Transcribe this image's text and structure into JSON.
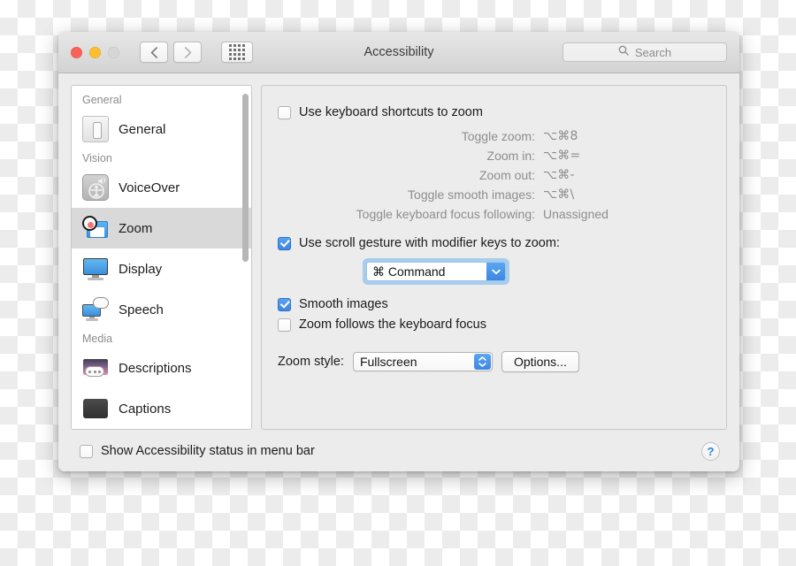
{
  "window": {
    "title": "Accessibility",
    "traffic_lights": [
      "close",
      "minimize",
      "zoom"
    ],
    "toolbar": {
      "back_icon": "chevron-left-icon",
      "forward_icon": "chevron-right-icon",
      "grid_icon": "show-all-grid-icon"
    },
    "search": {
      "placeholder": "Search",
      "icon": "search-icon"
    }
  },
  "sidebar": {
    "groups": [
      {
        "label": "General",
        "items": [
          {
            "label": "General",
            "icon": "general-switch-icon",
            "selected": false
          }
        ]
      },
      {
        "label": "Vision",
        "items": [
          {
            "label": "VoiceOver",
            "icon": "voiceover-icon",
            "selected": false
          },
          {
            "label": "Zoom",
            "icon": "zoom-icon",
            "selected": true
          },
          {
            "label": "Display",
            "icon": "display-monitor-icon",
            "selected": false
          },
          {
            "label": "Speech",
            "icon": "speech-bubble-icon",
            "selected": false
          }
        ]
      },
      {
        "label": "Media",
        "items": [
          {
            "label": "Descriptions",
            "icon": "descriptions-icon",
            "selected": false
          },
          {
            "label": "Captions",
            "icon": "captions-icon",
            "selected": false
          }
        ]
      }
    ]
  },
  "pane": {
    "keyboard_shortcuts": {
      "label": "Use keyboard shortcuts to zoom",
      "checked": false,
      "rows": [
        {
          "key": "Toggle zoom:",
          "value": "⌥⌘8"
        },
        {
          "key": "Zoom in:",
          "value": "⌥⌘="
        },
        {
          "key": "Zoom out:",
          "value": "⌥⌘-"
        },
        {
          "key": "Toggle smooth images:",
          "value": "⌥⌘\\"
        },
        {
          "key": "Toggle keyboard focus following:",
          "value": "Unassigned"
        }
      ]
    },
    "scroll_gesture": {
      "label": "Use scroll gesture with modifier keys to zoom:",
      "checked": true,
      "modifier_value": "⌘ Command",
      "arrow_icon": "chevron-down-icon"
    },
    "smooth_images": {
      "label": "Smooth images",
      "checked": true
    },
    "keyboard_focus": {
      "label": "Zoom follows the keyboard focus",
      "checked": false
    },
    "zoom_style": {
      "label": "Zoom style:",
      "value": "Fullscreen",
      "stepper_icon": "updown-chevron-icon",
      "options_button": "Options..."
    }
  },
  "footer": {
    "status_checkbox": {
      "label": "Show Accessibility status in menu bar",
      "checked": false
    },
    "help": {
      "label": "?",
      "icon": "help-question-icon"
    }
  }
}
